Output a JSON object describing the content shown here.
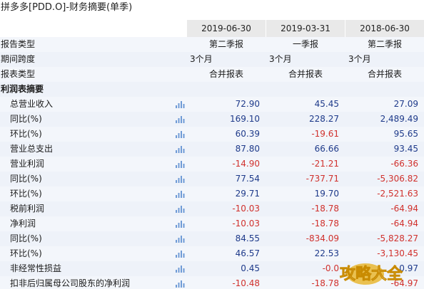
{
  "title": "拼多多[PDD.O]-财务摘要(单季)",
  "columns": [
    "2019-06-30",
    "2019-03-31",
    "2018-06-30"
  ],
  "meta_rows": [
    {
      "label": "报告类型",
      "align": "center",
      "values": [
        "第二季报",
        "一季报",
        "第二季报"
      ]
    },
    {
      "label": "期间跨度",
      "align": "left",
      "values": [
        "3个月",
        "3个月",
        "3个月"
      ]
    },
    {
      "label": "报表类型",
      "align": "center",
      "values": [
        "合并报表",
        "合并报表",
        "合并报表"
      ]
    }
  ],
  "section_label": "利润表摘要",
  "items": [
    {
      "label": "总营业收入",
      "values": [
        "72.90",
        "45.45",
        "27.09"
      ]
    },
    {
      "label": "同比(%)",
      "values": [
        "169.10",
        "228.27",
        "2,489.49"
      ]
    },
    {
      "label": "环比(%)",
      "values": [
        "60.39",
        "-19.61",
        "95.65"
      ]
    },
    {
      "label": "营业总支出",
      "values": [
        "87.80",
        "66.66",
        "93.45"
      ]
    },
    {
      "label": "营业利润",
      "values": [
        "-14.90",
        "-21.21",
        "-66.36"
      ]
    },
    {
      "label": "同比(%)",
      "values": [
        "77.54",
        "-737.71",
        "-5,306.82"
      ]
    },
    {
      "label": "环比(%)",
      "values": [
        "29.71",
        "19.70",
        "-2,521.63"
      ]
    },
    {
      "label": "税前利润",
      "values": [
        "-10.03",
        "-18.78",
        "-64.94"
      ]
    },
    {
      "label": "净利润",
      "values": [
        "-10.03",
        "-18.78",
        "-64.94"
      ]
    },
    {
      "label": "同比(%)",
      "values": [
        "84.55",
        "-834.09",
        "-5,828.27"
      ]
    },
    {
      "label": "环比(%)",
      "values": [
        "46.57",
        "22.53",
        "-3,130.45"
      ]
    },
    {
      "label": "非经常性损益",
      "values": [
        "0.45",
        "-0.0",
        "0.97"
      ]
    },
    {
      "label": "扣非后归属母公司股东的净利润",
      "values": [
        "-10.48",
        "-18.78",
        "-64.97"
      ]
    }
  ],
  "icon": "bar-chart-icon",
  "colors": {
    "positive": "#1e3a8a",
    "negative": "#d0312d",
    "header_bg": "#e9e9e9",
    "row_band": "#eef2f9",
    "chart_icon": "#6f9bd6"
  }
}
